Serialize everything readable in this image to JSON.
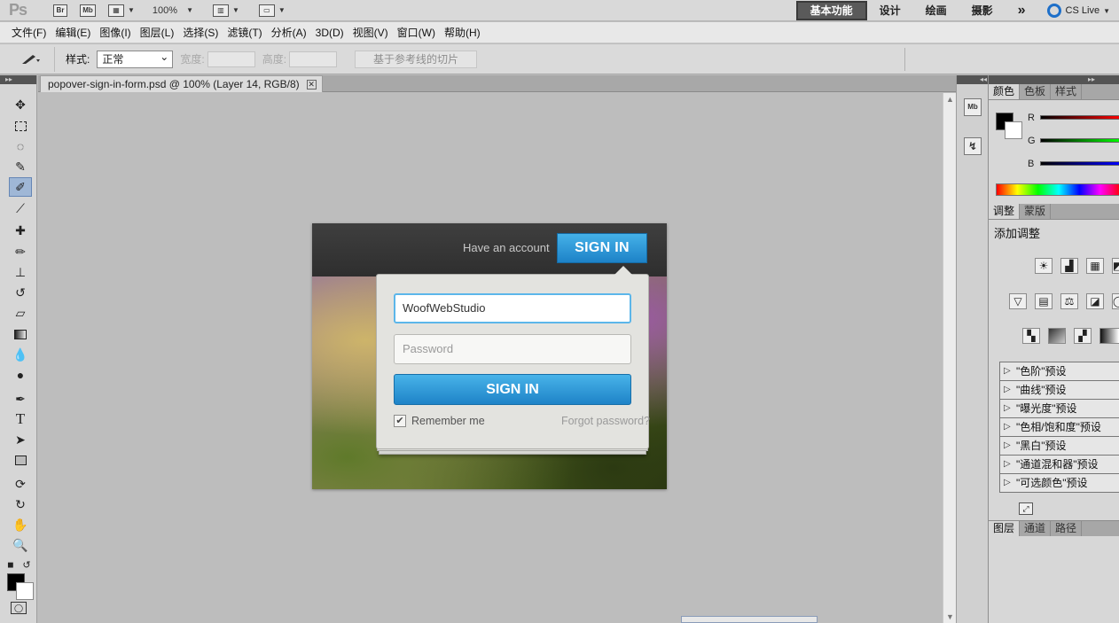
{
  "app": {
    "logo": "Ps",
    "bridge": "Br",
    "minibridge": "Mb",
    "zoom": "100%",
    "workspaces": [
      "基本功能",
      "设计",
      "绘画",
      "摄影"
    ],
    "more": "»",
    "cslive": "CS Live"
  },
  "menu": [
    "文件(F)",
    "编辑(E)",
    "图像(I)",
    "图层(L)",
    "选择(S)",
    "滤镜(T)",
    "分析(A)",
    "3D(D)",
    "视图(V)",
    "窗口(W)",
    "帮助(H)"
  ],
  "options": {
    "style_label": "样式:",
    "style_value": "正常",
    "width_label": "宽度:",
    "height_label": "高度:",
    "slice_button": "基于参考线的切片"
  },
  "document": {
    "tab_title": "popover-sign-in-form.psd @ 100% (Layer 14, RGB/8)",
    "close": "✕"
  },
  "artwork": {
    "have_account": "Have an account",
    "top_signin": "SIGN IN",
    "username_value": "WoofWebStudio",
    "password_placeholder": "Password",
    "signin_button": "SIGN IN",
    "remember": "Remember me",
    "checkmark": "✔",
    "forgot": "Forgot password?"
  },
  "color_panel": {
    "tabs": [
      "颜色",
      "色板",
      "样式"
    ],
    "r": "R",
    "g": "G",
    "b": "B"
  },
  "adjust_panel": {
    "tabs": [
      "调整",
      "蒙版"
    ],
    "title": "添加调整",
    "presets": [
      "\"色阶\"预设",
      "\"曲线\"预设",
      "\"曝光度\"预设",
      "\"色相/饱和度\"预设",
      "\"黑白\"预设",
      "\"通道混和器\"预设",
      "\"可选颜色\"预设"
    ]
  },
  "layers_panel": {
    "tabs": [
      "图层",
      "通道",
      "路径"
    ]
  }
}
